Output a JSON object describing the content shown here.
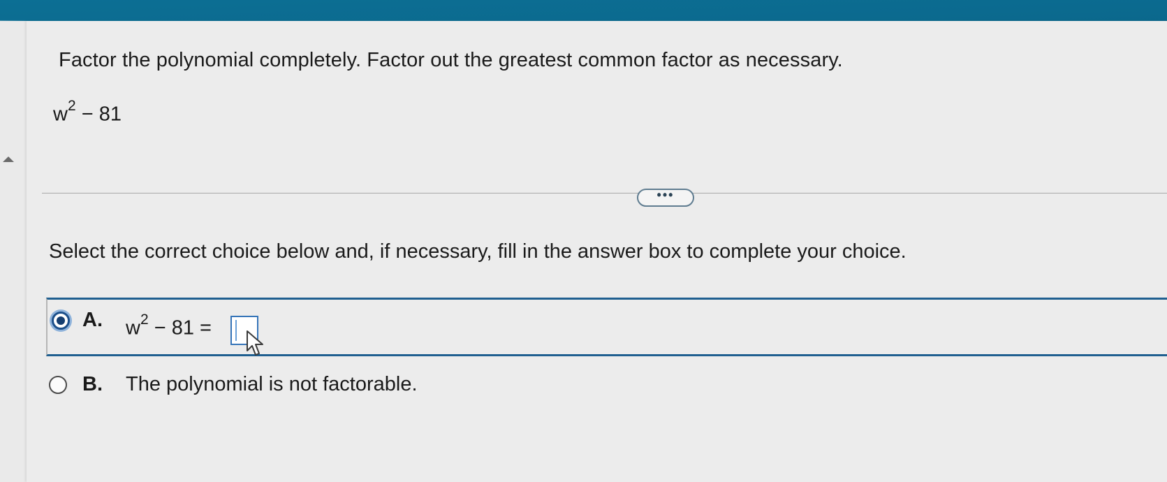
{
  "question": {
    "prompt": "Factor the polynomial completely. Factor out the greatest common factor as necessary.",
    "expression_base": "w",
    "expression_exponent": "2",
    "expression_rest": " − 81"
  },
  "more_button": {
    "label": "•••"
  },
  "instructions": "Select the correct choice below and, if necessary, fill in the answer box to complete your choice.",
  "choices": [
    {
      "letter": "A.",
      "expr_base": "w",
      "expr_exponent": "2",
      "expr_rest": " − 81 =",
      "selected": true,
      "answer_value": ""
    },
    {
      "letter": "B.",
      "text": "The polynomial is not factorable.",
      "selected": false
    }
  ],
  "colors": {
    "header": "#0b6a8f",
    "accent": "#1f5f90",
    "radio_selected": "#153e70"
  },
  "icons": {
    "cursor": "mouse-pointer-icon",
    "collapse": "triangle-up-icon"
  }
}
